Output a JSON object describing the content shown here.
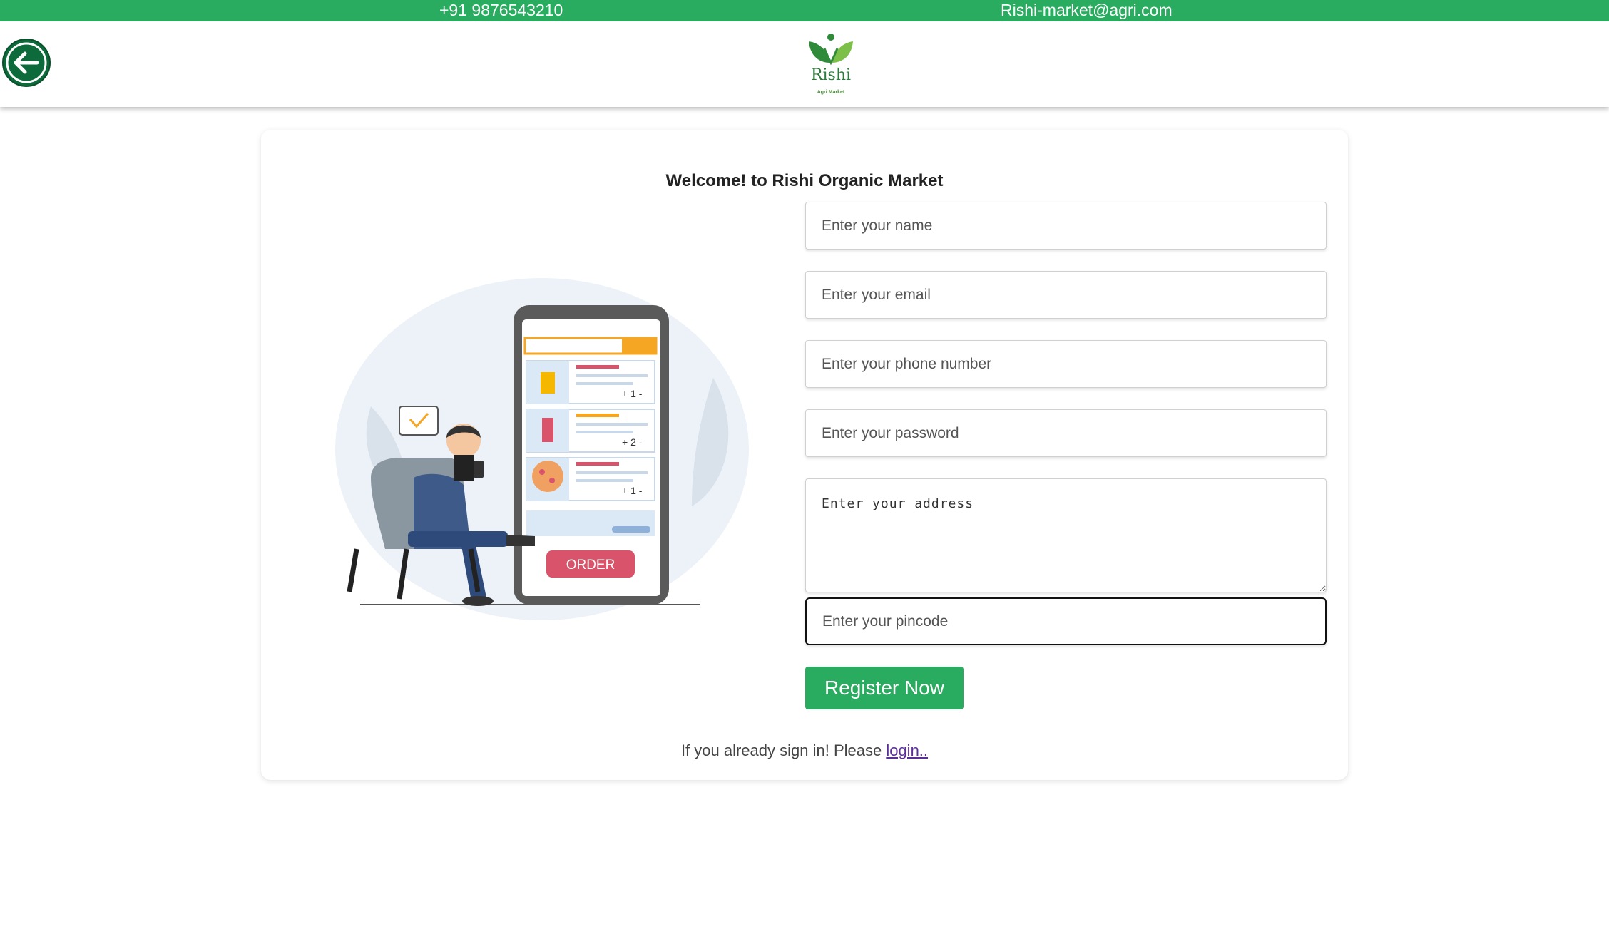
{
  "topbar": {
    "phone": "+91 9876543210",
    "email": "Rishi-market@agri.com"
  },
  "header": {
    "back_icon": "arrow-left-icon",
    "logo": {
      "name": "Rishi",
      "sub": "Agri Market"
    }
  },
  "form": {
    "title": "Welcome! to Rishi Organic Market",
    "name_placeholder": "Enter your name",
    "email_placeholder": "Enter your email",
    "phone_placeholder": "Enter your phone number",
    "password_placeholder": "Enter your password",
    "address_placeholder": "Enter your address",
    "pincode_placeholder": "Enter your pincode",
    "submit_label": "Register Now",
    "signin_text": "If you already sign in! Please ",
    "login_link": "login.."
  },
  "illustration": {
    "order_label": "ORDER",
    "qty_1": "+ 1 -",
    "qty_2": "+ 2 -",
    "qty_3": "+ 1 -"
  },
  "colors": {
    "brand_green": "#2aac60",
    "back_button": "#0d6a3a",
    "order_button": "#d9546a",
    "search_orange": "#f5a623"
  }
}
